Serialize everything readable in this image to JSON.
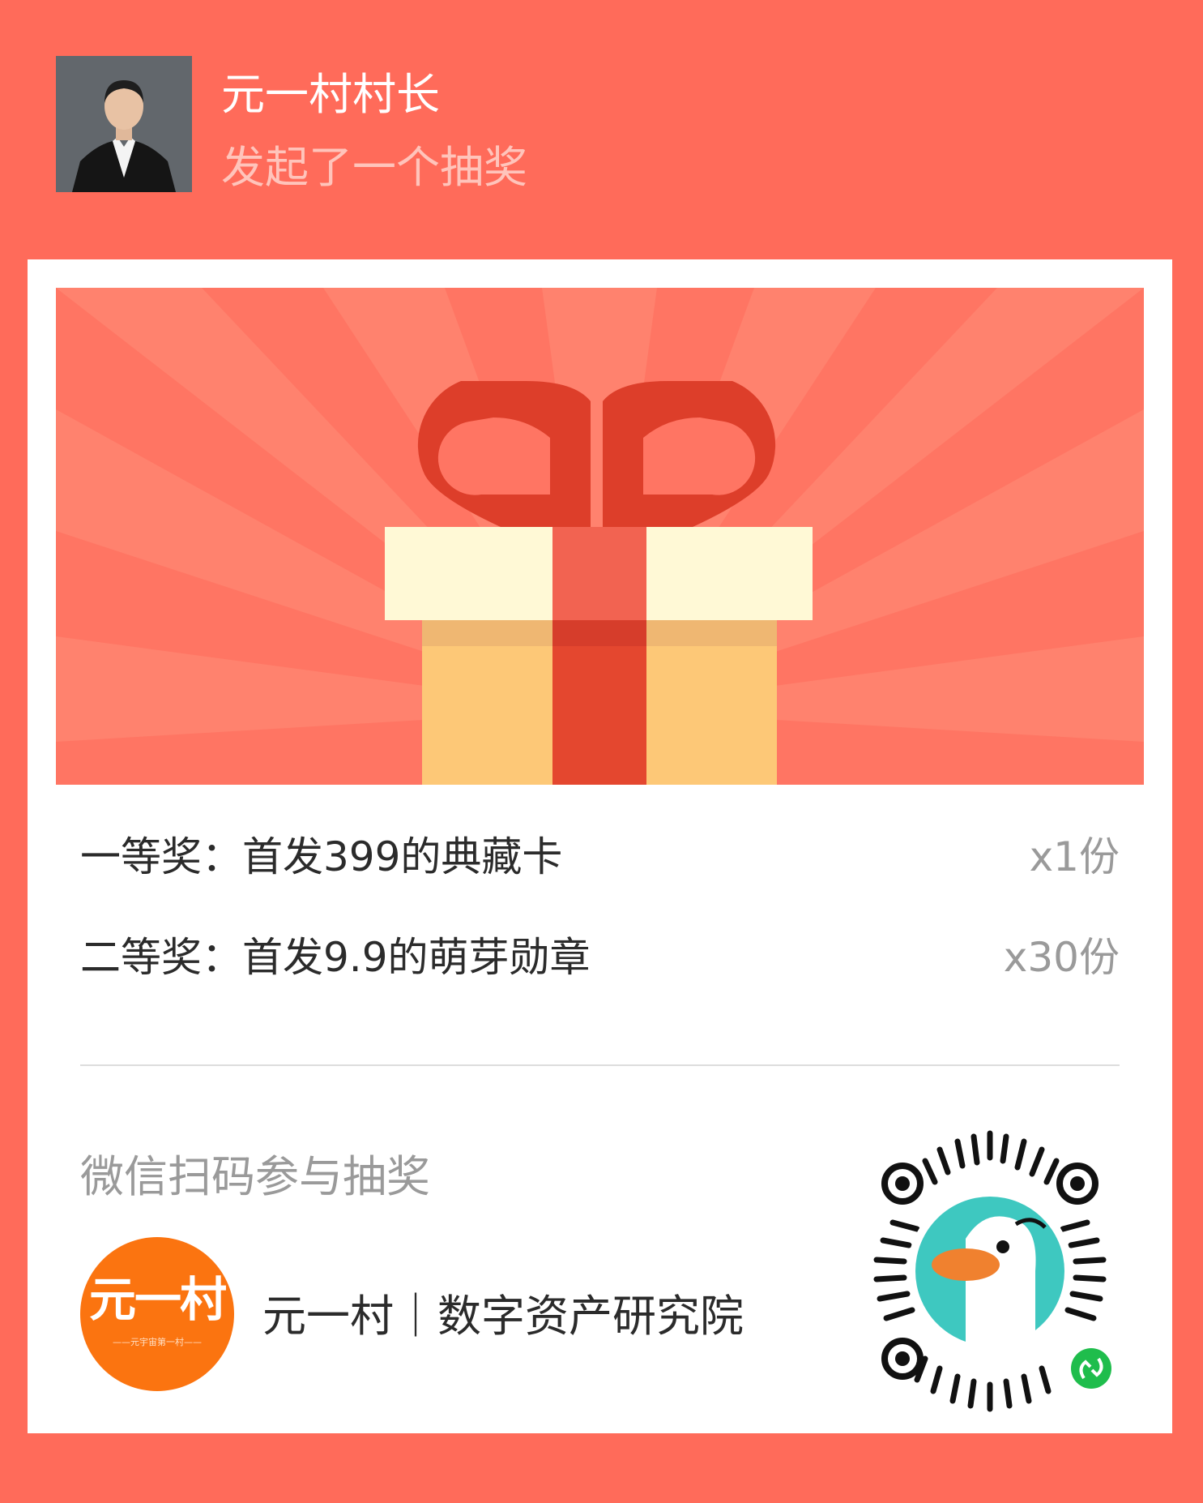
{
  "header": {
    "user_name": "元一村村长",
    "action": "发起了一个抽奖"
  },
  "prizes": [
    {
      "label": "一等奖：首发399的典藏卡",
      "count": "x1份"
    },
    {
      "label": "二等奖：首发9.9的萌芽勋章",
      "count": "x30份"
    }
  ],
  "footer": {
    "scan_hint": "微信扫码参与抽奖",
    "brand_name": "元一村｜数字资产研究院",
    "logo_text": "元一村",
    "logo_subtext": "——元宇宙第一村——"
  },
  "colors": {
    "page_background": "#ff6b5a",
    "banner_background": "#ff7563",
    "ribbon": "#dd3e2a",
    "gift_lid": "#fff9d6",
    "gift_box": "#fdc877",
    "logo_orange": "#fb7410",
    "mini_program_green": "#1fbd4c"
  },
  "icons": {
    "banner": "gift-box-icon",
    "qr": "wechat-mini-program-code",
    "qr_center": "duck-mascot-icon",
    "qr_badge": "mini-program-link-icon"
  }
}
